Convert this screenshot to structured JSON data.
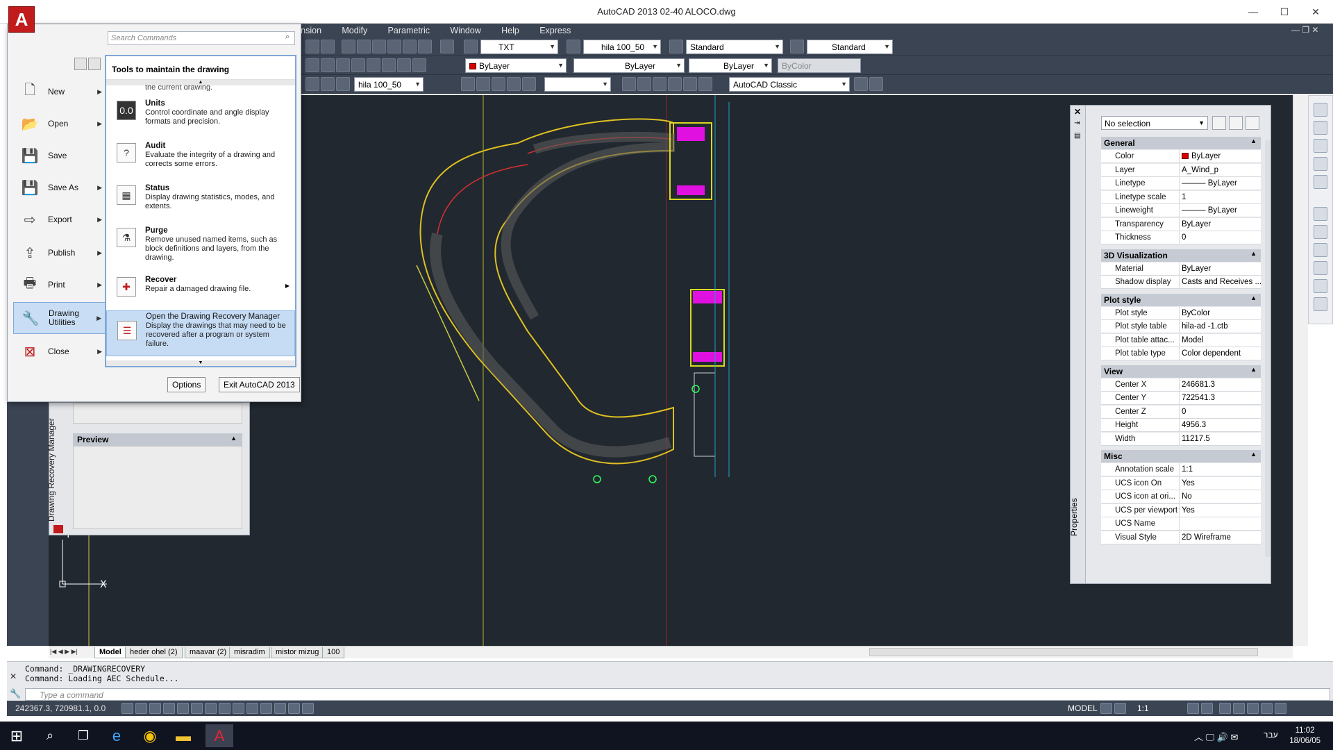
{
  "window": {
    "title": "AutoCAD 2013     02-40 ALOCO.dwg"
  },
  "menu": [
    "imension",
    "Modify",
    "Parametric",
    "Window",
    "Help",
    "Express"
  ],
  "toolbars": {
    "text_style": "TXT",
    "dim_style": "hila 100_50",
    "table_style": "Standard",
    "mleader_style": "Standard",
    "color": "ByLayer",
    "linetype": "ByLayer",
    "lineweight": "ByLayer",
    "plot_style": "ByColor",
    "layer_dim": "hila 100_50",
    "workspace": "AutoCAD Classic"
  },
  "app_menu": {
    "search_placeholder": "Search Commands",
    "left_items": [
      {
        "label": "New",
        "icon": "new-icon"
      },
      {
        "label": "Open",
        "icon": "open-icon"
      },
      {
        "label": "Save",
        "icon": "save-icon"
      },
      {
        "label": "Save As",
        "icon": "save-as-icon"
      },
      {
        "label": "Export",
        "icon": "export-icon"
      },
      {
        "label": "Publish",
        "icon": "publish-icon"
      },
      {
        "label": "Print",
        "icon": "print-icon"
      },
      {
        "label": "Drawing Utilities",
        "icon": "drawing-utilities-icon"
      },
      {
        "label": "Close",
        "icon": "close-icon"
      }
    ],
    "submenu": {
      "header": "Tools to maintain the drawing",
      "cut_text": "the current drawing.",
      "items": [
        {
          "title": "Units",
          "desc": "Control coordinate and angle display formats and precision.",
          "icon": "0.0"
        },
        {
          "title": "Audit",
          "desc": "Evaluate the integrity of a drawing and corrects some errors.",
          "icon": "?"
        },
        {
          "title": "Status",
          "desc": "Display drawing statistics, modes, and extents.",
          "icon": "▦"
        },
        {
          "title": "Purge",
          "desc": "Remove unused named items, such as block definitions and layers, from the drawing.",
          "icon": "⚗"
        },
        {
          "title": "Recover",
          "desc": "Repair a damaged drawing file.",
          "icon": "✚"
        },
        {
          "title": "Open the Drawing Recovery Manager",
          "desc": "Display the drawings that may need to be recovered after a program or system failure.",
          "icon": "☰"
        }
      ]
    },
    "options_label": "Options",
    "exit_label": "Exit AutoCAD 2013"
  },
  "recovery_panel": {
    "title": "Drawing Recovery Manager",
    "preview_label": "Preview"
  },
  "properties": {
    "title": "Properties",
    "selection": "No selection",
    "sections": [
      {
        "name": "General",
        "rows": [
          [
            "Color",
            "ByLayer"
          ],
          [
            "Layer",
            "A_Wind_p"
          ],
          [
            "Linetype",
            "——— ByLayer"
          ],
          [
            "Linetype scale",
            "1"
          ],
          [
            "Lineweight",
            "——— ByLayer"
          ],
          [
            "Transparency",
            "ByLayer"
          ],
          [
            "Thickness",
            "0"
          ]
        ]
      },
      {
        "name": "3D Visualization",
        "rows": [
          [
            "Material",
            "ByLayer"
          ],
          [
            "Shadow display",
            "Casts and Receives ..."
          ]
        ]
      },
      {
        "name": "Plot style",
        "rows": [
          [
            "Plot style",
            "ByColor"
          ],
          [
            "Plot style table",
            "hila-ad -1.ctb"
          ],
          [
            "Plot table attac...",
            "Model"
          ],
          [
            "Plot table type",
            "Color dependent"
          ]
        ]
      },
      {
        "name": "View",
        "rows": [
          [
            "Center X",
            "246681.3"
          ],
          [
            "Center Y",
            "722541.3"
          ],
          [
            "Center Z",
            "0"
          ],
          [
            "Height",
            "4956.3"
          ],
          [
            "Width",
            "11217.5"
          ]
        ]
      },
      {
        "name": "Misc",
        "rows": [
          [
            "Annotation scale",
            "1:1"
          ],
          [
            "UCS icon On",
            "Yes"
          ],
          [
            "UCS icon at ori...",
            "No"
          ],
          [
            "UCS per viewport",
            "Yes"
          ],
          [
            "UCS Name",
            ""
          ],
          [
            "Visual Style",
            "2D Wireframe"
          ]
        ]
      }
    ]
  },
  "layout_tabs": [
    "Model",
    "heder ohel (2)",
    "maavar (2)",
    "misradim",
    "mistor mizug",
    "100"
  ],
  "command": {
    "lines": [
      "Command: _DRAWINGRECOVERY",
      "Command: Loading AEC Schedule..."
    ],
    "placeholder": "Type a command"
  },
  "status": {
    "coords": "242367.3, 720981.1, 0.0",
    "model_label": "MODEL",
    "scale": "1:1"
  },
  "taskbar": {
    "time": "11:02",
    "date": "18/06/05",
    "lang": "עבר"
  },
  "colors": {
    "ui_dark": "#3b4453",
    "canvas": "#212830",
    "accent": "#c21b1b"
  }
}
